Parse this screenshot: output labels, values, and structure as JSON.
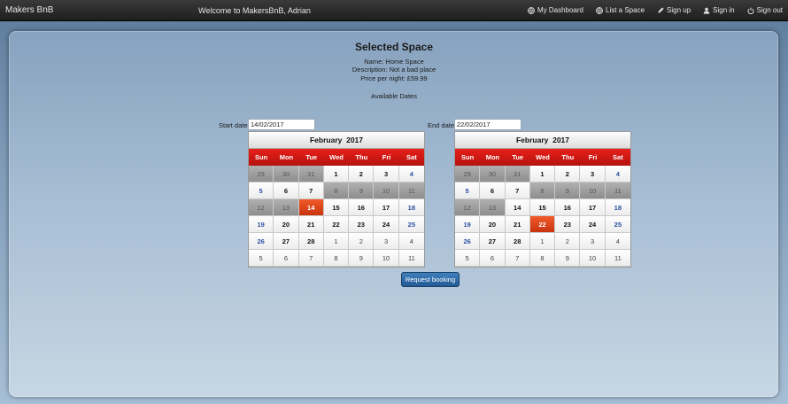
{
  "nav": {
    "brand": "Makers BnB",
    "welcome": "Welcome to MakersBnB, Adrian",
    "links": [
      {
        "label": "My Dashboard",
        "icon": "globe-icon"
      },
      {
        "label": "List a Space",
        "icon": "globe-icon"
      },
      {
        "label": "Sign up",
        "icon": "pencil-icon"
      },
      {
        "label": "Sign in",
        "icon": "user-icon"
      },
      {
        "label": "Sign out",
        "icon": "power-icon"
      }
    ]
  },
  "space": {
    "title": "Selected Space",
    "name": "Name: Home Space",
    "description": "Description: Not a bad place",
    "price": "Price per night: £59.99",
    "available": "Available Dates"
  },
  "start": {
    "label": "Start date",
    "value": "14/02/2017",
    "calendar": {
      "month": "February",
      "year": "2017",
      "days": [
        "Sun",
        "Mon",
        "Tue",
        "Wed",
        "Thu",
        "Fri",
        "Sat"
      ],
      "cells": [
        {
          "d": "29",
          "s": "disabled"
        },
        {
          "d": "30",
          "s": "disabled"
        },
        {
          "d": "31",
          "s": "disabled"
        },
        {
          "d": "1",
          "s": ""
        },
        {
          "d": "2",
          "s": ""
        },
        {
          "d": "3",
          "s": ""
        },
        {
          "d": "4",
          "s": "weekend"
        },
        {
          "d": "5",
          "s": "weekend"
        },
        {
          "d": "6",
          "s": ""
        },
        {
          "d": "7",
          "s": ""
        },
        {
          "d": "8",
          "s": "disabled"
        },
        {
          "d": "9",
          "s": "disabled"
        },
        {
          "d": "10",
          "s": "disabled"
        },
        {
          "d": "11",
          "s": "disabled"
        },
        {
          "d": "12",
          "s": "disabled"
        },
        {
          "d": "13",
          "s": "disabled"
        },
        {
          "d": "14",
          "s": "selected"
        },
        {
          "d": "15",
          "s": ""
        },
        {
          "d": "16",
          "s": ""
        },
        {
          "d": "17",
          "s": ""
        },
        {
          "d": "18",
          "s": "weekend"
        },
        {
          "d": "19",
          "s": "weekend"
        },
        {
          "d": "20",
          "s": ""
        },
        {
          "d": "21",
          "s": ""
        },
        {
          "d": "22",
          "s": ""
        },
        {
          "d": "23",
          "s": ""
        },
        {
          "d": "24",
          "s": ""
        },
        {
          "d": "25",
          "s": "weekend"
        },
        {
          "d": "26",
          "s": "weekend"
        },
        {
          "d": "27",
          "s": ""
        },
        {
          "d": "28",
          "s": ""
        },
        {
          "d": "1",
          "s": "other"
        },
        {
          "d": "2",
          "s": "other"
        },
        {
          "d": "3",
          "s": "other"
        },
        {
          "d": "4",
          "s": "other"
        },
        {
          "d": "5",
          "s": "other"
        },
        {
          "d": "6",
          "s": "other"
        },
        {
          "d": "7",
          "s": "other"
        },
        {
          "d": "8",
          "s": "other"
        },
        {
          "d": "9",
          "s": "other"
        },
        {
          "d": "10",
          "s": "other"
        },
        {
          "d": "11",
          "s": "other"
        }
      ]
    }
  },
  "end": {
    "label": "End date",
    "value": "22/02/2017",
    "calendar": {
      "month": "February",
      "year": "2017",
      "days": [
        "Sun",
        "Mon",
        "Tue",
        "Wed",
        "Thu",
        "Fri",
        "Sat"
      ],
      "cells": [
        {
          "d": "29",
          "s": "disabled"
        },
        {
          "d": "30",
          "s": "disabled"
        },
        {
          "d": "31",
          "s": "disabled"
        },
        {
          "d": "1",
          "s": ""
        },
        {
          "d": "2",
          "s": ""
        },
        {
          "d": "3",
          "s": ""
        },
        {
          "d": "4",
          "s": "weekend"
        },
        {
          "d": "5",
          "s": "weekend"
        },
        {
          "d": "6",
          "s": ""
        },
        {
          "d": "7",
          "s": ""
        },
        {
          "d": "8",
          "s": "disabled"
        },
        {
          "d": "9",
          "s": "disabled"
        },
        {
          "d": "10",
          "s": "disabled"
        },
        {
          "d": "11",
          "s": "disabled"
        },
        {
          "d": "12",
          "s": "disabled"
        },
        {
          "d": "13",
          "s": "disabled"
        },
        {
          "d": "14",
          "s": ""
        },
        {
          "d": "15",
          "s": ""
        },
        {
          "d": "16",
          "s": ""
        },
        {
          "d": "17",
          "s": ""
        },
        {
          "d": "18",
          "s": "weekend"
        },
        {
          "d": "19",
          "s": "weekend"
        },
        {
          "d": "20",
          "s": ""
        },
        {
          "d": "21",
          "s": ""
        },
        {
          "d": "22",
          "s": "selected"
        },
        {
          "d": "23",
          "s": ""
        },
        {
          "d": "24",
          "s": ""
        },
        {
          "d": "25",
          "s": "weekend"
        },
        {
          "d": "26",
          "s": "weekend"
        },
        {
          "d": "27",
          "s": ""
        },
        {
          "d": "28",
          "s": ""
        },
        {
          "d": "1",
          "s": "other"
        },
        {
          "d": "2",
          "s": "other"
        },
        {
          "d": "3",
          "s": "other"
        },
        {
          "d": "4",
          "s": "other"
        },
        {
          "d": "5",
          "s": "other"
        },
        {
          "d": "6",
          "s": "other"
        },
        {
          "d": "7",
          "s": "other"
        },
        {
          "d": "8",
          "s": "other"
        },
        {
          "d": "9",
          "s": "other"
        },
        {
          "d": "10",
          "s": "other"
        },
        {
          "d": "11",
          "s": "other"
        }
      ]
    }
  },
  "actions": {
    "request_booking": "Request booking"
  },
  "colors": {
    "accent_red": "#d8160f",
    "selected_orange": "#e0441a",
    "button_blue": "#2f6aa6"
  }
}
